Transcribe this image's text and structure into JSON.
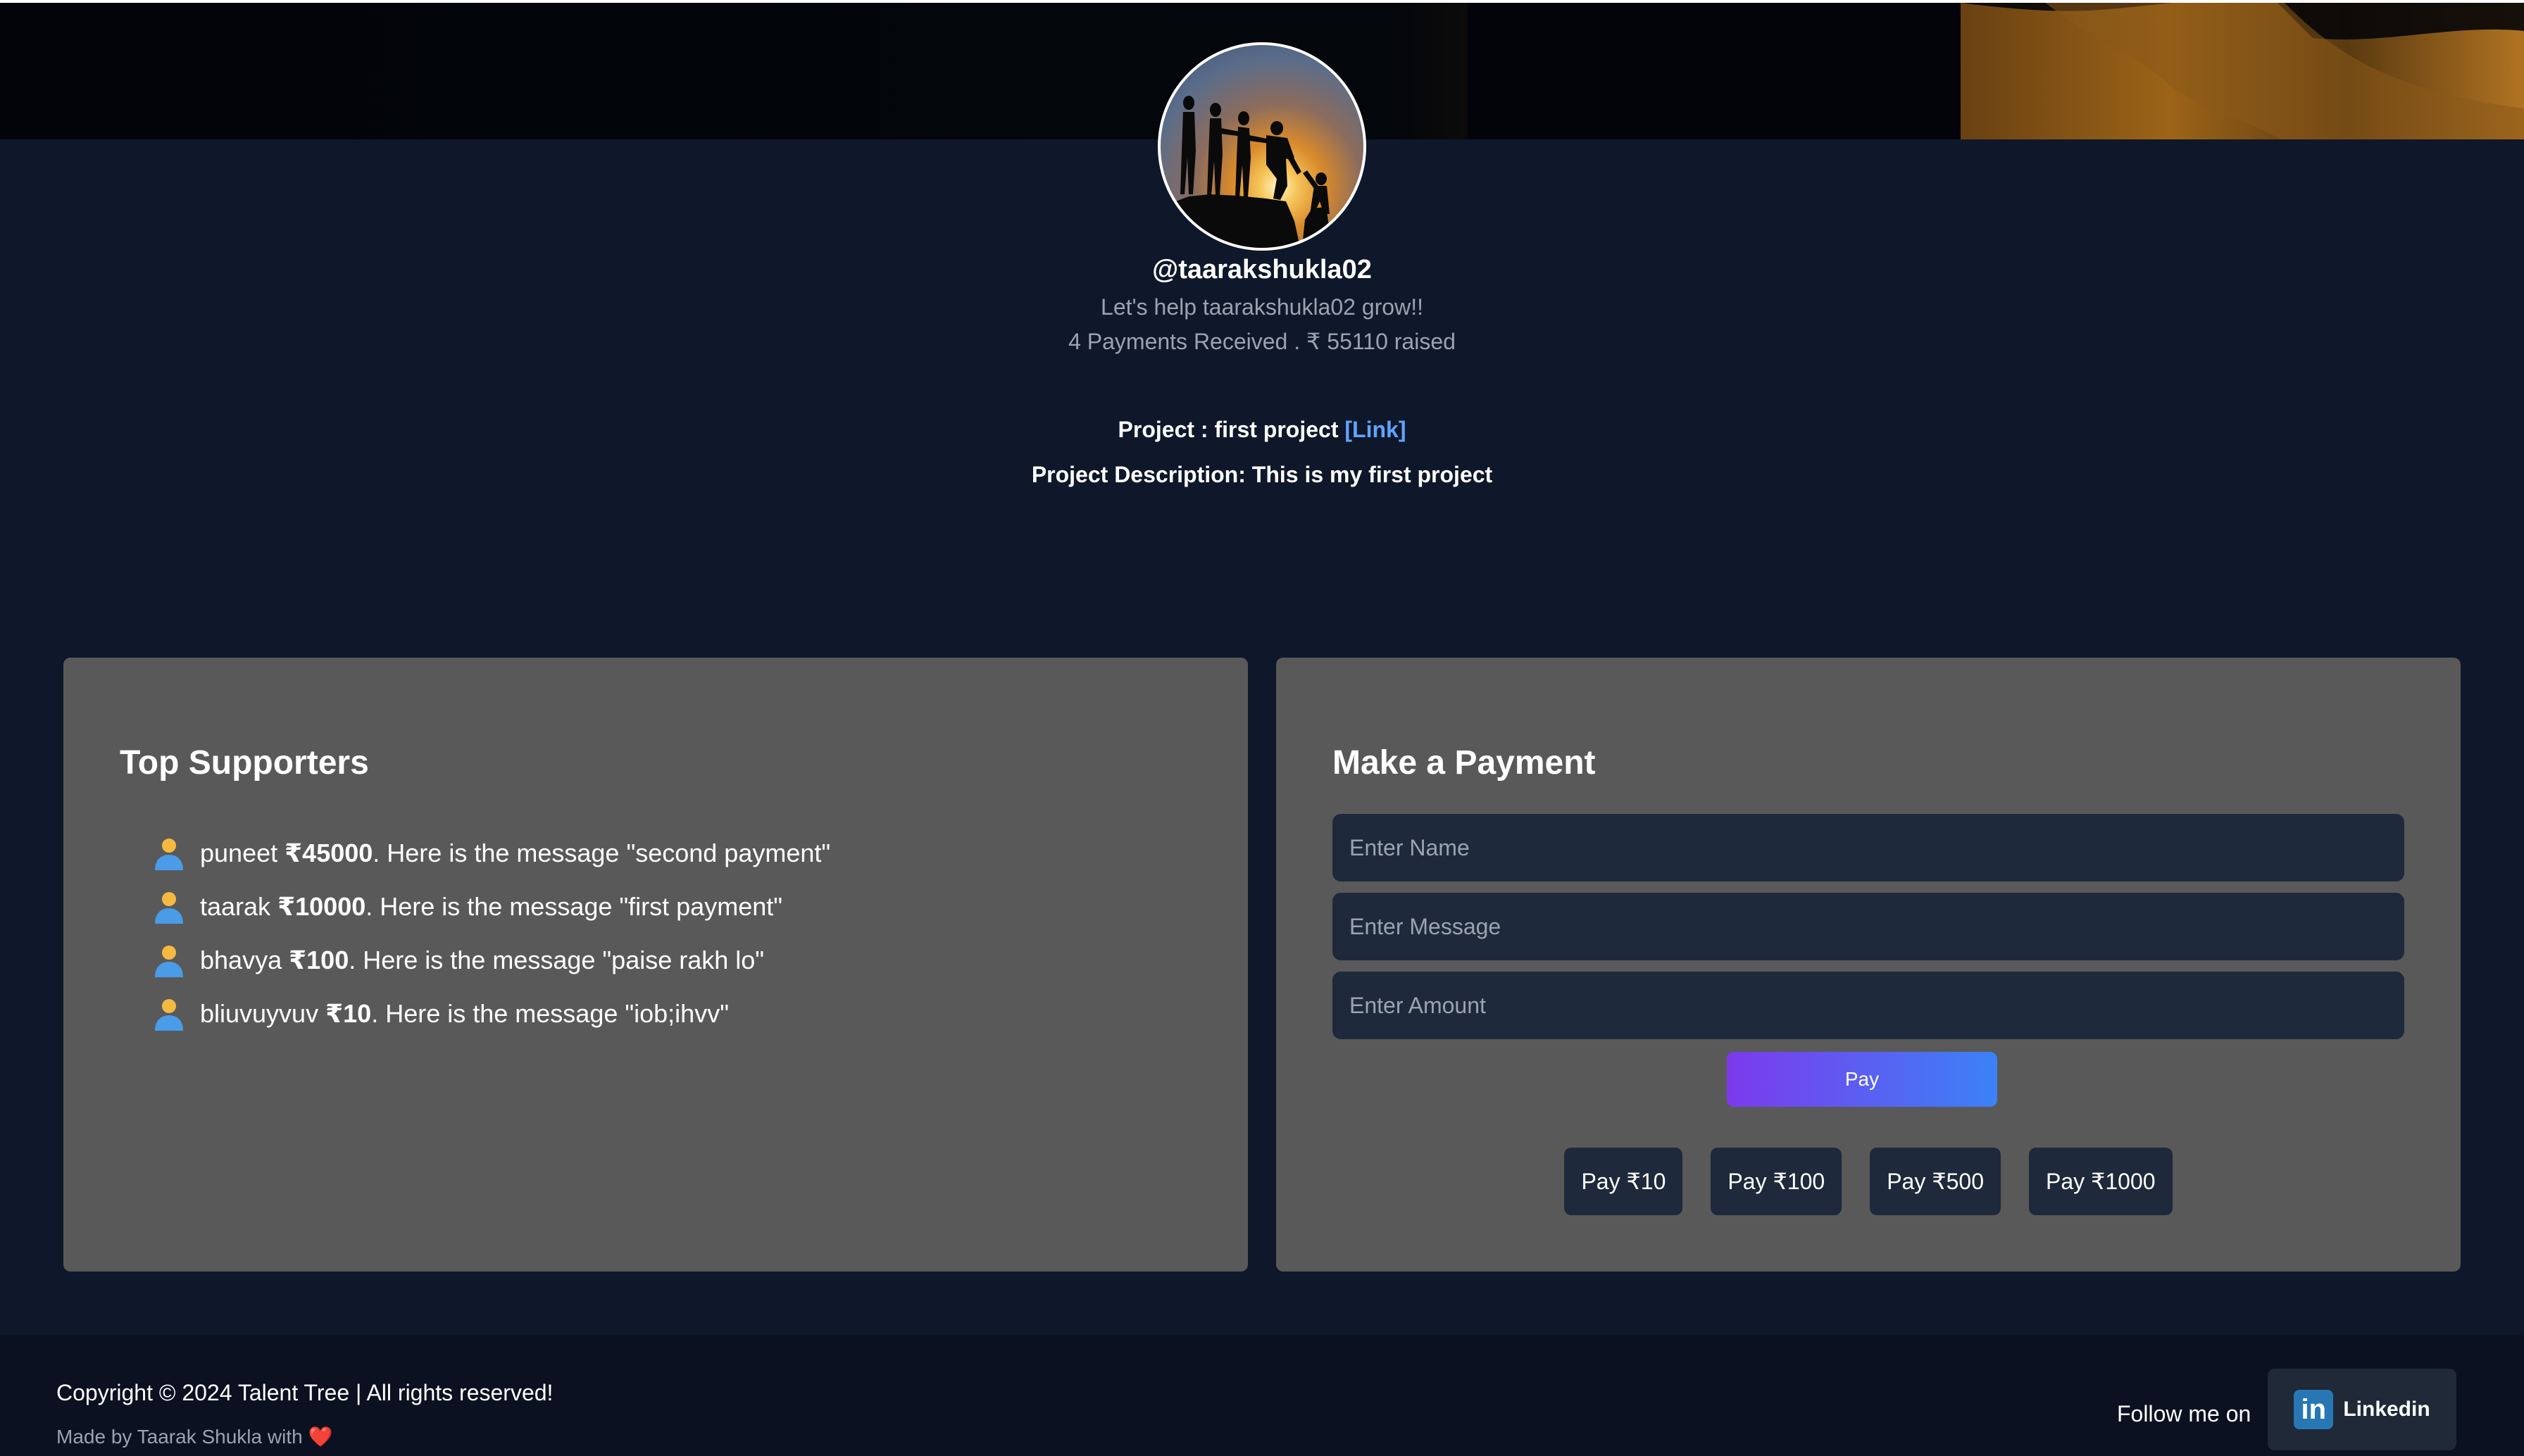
{
  "profile": {
    "username": "@taarakshukla02",
    "tagline": "Let's help taarakshukla02 grow!!",
    "stats": "4 Payments Received . ₹ 55110 raised"
  },
  "project": {
    "title_prefix": "Project : first project ",
    "link_label": "[Link]",
    "description": "Project Description: This is my first project"
  },
  "supporters": {
    "title": "Top Supporters",
    "items": [
      {
        "name": "puneet",
        "amount": "₹45000",
        "rest": ". Here is the message \"second payment\""
      },
      {
        "name": "taarak",
        "amount": "₹10000",
        "rest": ". Here is the message \"first payment\""
      },
      {
        "name": "bhavya",
        "amount": "₹100",
        "rest": ". Here is the message \"paise rakh lo\""
      },
      {
        "name": "bliuvuyvuv",
        "amount": "₹10",
        "rest": ". Here is the message \"iob;ihvv\""
      }
    ]
  },
  "payment": {
    "title": "Make a Payment",
    "name_placeholder": "Enter Name",
    "message_placeholder": "Enter Message",
    "amount_placeholder": "Enter Amount",
    "pay_label": "Pay",
    "quick": [
      "Pay ₹10",
      "Pay ₹100",
      "Pay ₹500",
      "Pay ₹1000"
    ]
  },
  "footer": {
    "copyright": "Copyright © 2024 Talent Tree | All rights reserved!",
    "made_by": "Made by Taarak Shukla with ",
    "heart": "❤️",
    "follow": "Follow me on",
    "linkedin_logo": "in",
    "linkedin_label": "Linkedin"
  },
  "icons": {
    "avatar": "people-helping-climb-silhouette",
    "supporter": "person-icon",
    "linkedin": "linkedin-icon"
  },
  "colors": {
    "background": "#0f172a",
    "card": "#595959",
    "input": "#1e293b",
    "link": "#60a5fa",
    "pay_gradient_start": "#7c3aed",
    "pay_gradient_end": "#3b82f6",
    "linkedin": "#2877b5"
  }
}
